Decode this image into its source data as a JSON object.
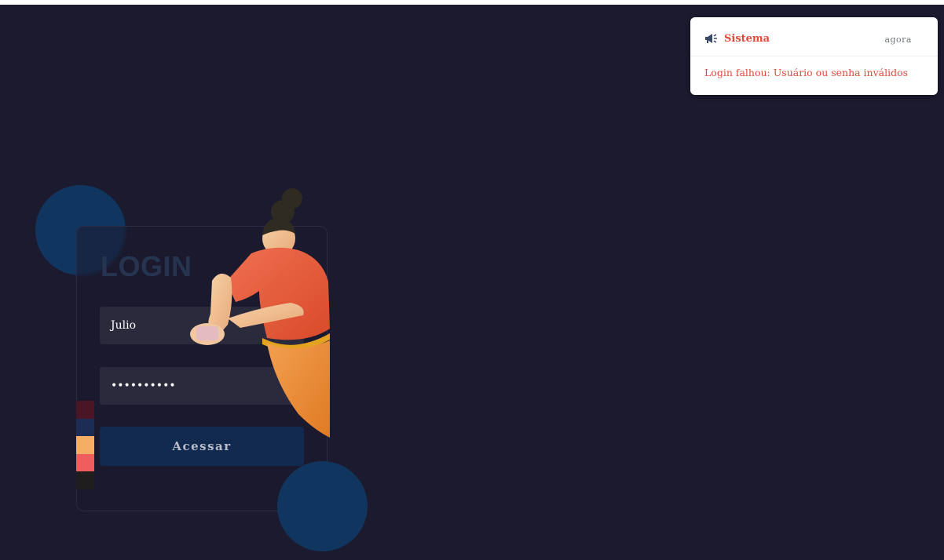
{
  "notification": {
    "icon": "megaphone-icon",
    "title": "Sistema",
    "time": "agora",
    "message": "Login falhou: Usuário ou senha inválidos"
  },
  "login": {
    "title": "LOGIN",
    "username_value": "Julio",
    "password_value": "••••••••••",
    "submit_label": "Acessar"
  },
  "palette": [
    "#4a1525",
    "#1c2c55",
    "#f4ad62",
    "#ee5e5e",
    "#1f1d1d"
  ],
  "colors": {
    "background": "#1b1a2e",
    "accent_circle": "#10365f",
    "error": "#e04a3c",
    "button": "#122a4f"
  }
}
